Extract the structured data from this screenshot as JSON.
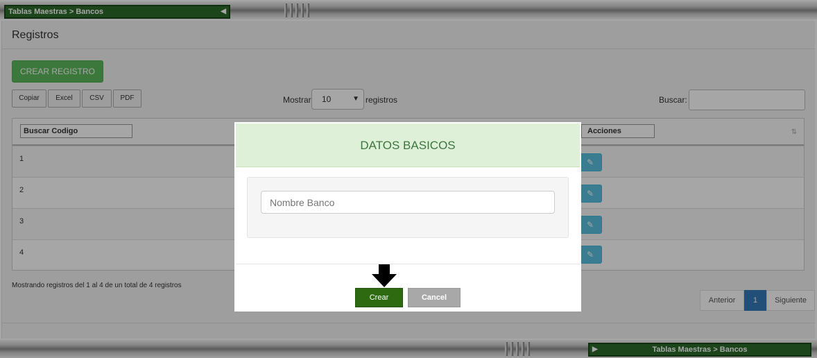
{
  "chrome": {
    "top_tab": "Tablas Maestras > Bancos",
    "bottom_tab": "Tablas Maestras > Bancos"
  },
  "page": {
    "title": "Registros",
    "create_button": "CREAR REGISTRO",
    "export_buttons": [
      "Copiar",
      "Excel",
      "CSV",
      "PDF"
    ],
    "show_label": "Mostrar",
    "show_value": "10",
    "records_label": "registros",
    "search_label": "Buscar:",
    "filter_codigo": "Buscar Codigo",
    "filter_acciones": "Acciones",
    "rows": [
      "1",
      "2",
      "3",
      "4"
    ],
    "footer_text": "Mostrando registros del 1 al 4 de un total de 4 registros",
    "pagination": {
      "prev": "Anterior",
      "current": "1",
      "next": "Siguiente"
    }
  },
  "modal": {
    "title": "DATOS BASICOS",
    "input_placeholder": "Nombre Banco",
    "create_label": "Crear",
    "cancel_label": "Cancel"
  },
  "colors": {
    "accent_green": "#5cb85c",
    "modal_header": "#dff0d8",
    "crear_button": "#2e6b10",
    "edit_button": "#5bc0de",
    "pagination_active": "#337ab7"
  }
}
